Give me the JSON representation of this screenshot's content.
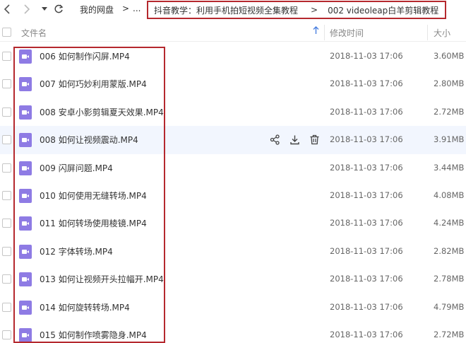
{
  "nav": {
    "back_icon": "chevron-left-icon",
    "forward_icon": "chevron-right-icon",
    "dropdown_icon": "caret-down-icon",
    "refresh_icon": "refresh-icon"
  },
  "breadcrumb": {
    "root": "我的网盘",
    "sep1": ">",
    "ellipsis": "...",
    "folder1": "抖音教学：利用手机拍短视频全集教程",
    "sep2": ">",
    "folder2": "002 videoleap白羊剪辑教程",
    "sep3": ">"
  },
  "header": {
    "name": "文件名",
    "sort_icon": "arrow-up-icon",
    "date": "修改时间",
    "size": "大小"
  },
  "files": [
    {
      "name": "006 如何制作闪屏.MP4",
      "date": "2018-11-03 17:06",
      "size": "3.60MB"
    },
    {
      "name": "007 如何巧妙利用蒙版.MP4",
      "date": "2018-11-03 17:06",
      "size": "2.80MB"
    },
    {
      "name": "008 安卓小影剪辑夏天效果.MP4",
      "date": "2018-11-03 17:06",
      "size": "2.72MB"
    },
    {
      "name": "008 如何让视频震动.MP4",
      "date": "2018-11-03 17:06",
      "size": "3.91MB"
    },
    {
      "name": "009 闪屏问题.MP4",
      "date": "2018-11-03 17:06",
      "size": "3.44MB"
    },
    {
      "name": "010 如何使用无缝转场.MP4",
      "date": "2018-11-03 17:06",
      "size": "4.08MB"
    },
    {
      "name": "011 如何转场使用棱镜.MP4",
      "date": "2018-11-03 17:06",
      "size": "4.24MB"
    },
    {
      "name": "012 字体转场.MP4",
      "date": "2018-11-03 17:06",
      "size": "2.82MB"
    },
    {
      "name": "013 如何让视频开头拉幅开.MP4",
      "date": "2018-11-03 17:06",
      "size": "2.78MB"
    },
    {
      "name": "014 如何旋转转场.MP4",
      "date": "2018-11-03 17:06",
      "size": "4.79MB"
    },
    {
      "name": "015 如何制作喷雾隐身.MP4",
      "date": "2018-11-03 17:06",
      "size": "2.72MB"
    }
  ],
  "hover_row_index": 3,
  "row_actions": [
    "share-icon",
    "download-icon",
    "delete-icon"
  ],
  "colors": {
    "highlight_box": "#b5282e",
    "file_icon": "#8e7be4",
    "hover_row": "#f2f6fe",
    "sort_accent": "#4a7fe0"
  }
}
